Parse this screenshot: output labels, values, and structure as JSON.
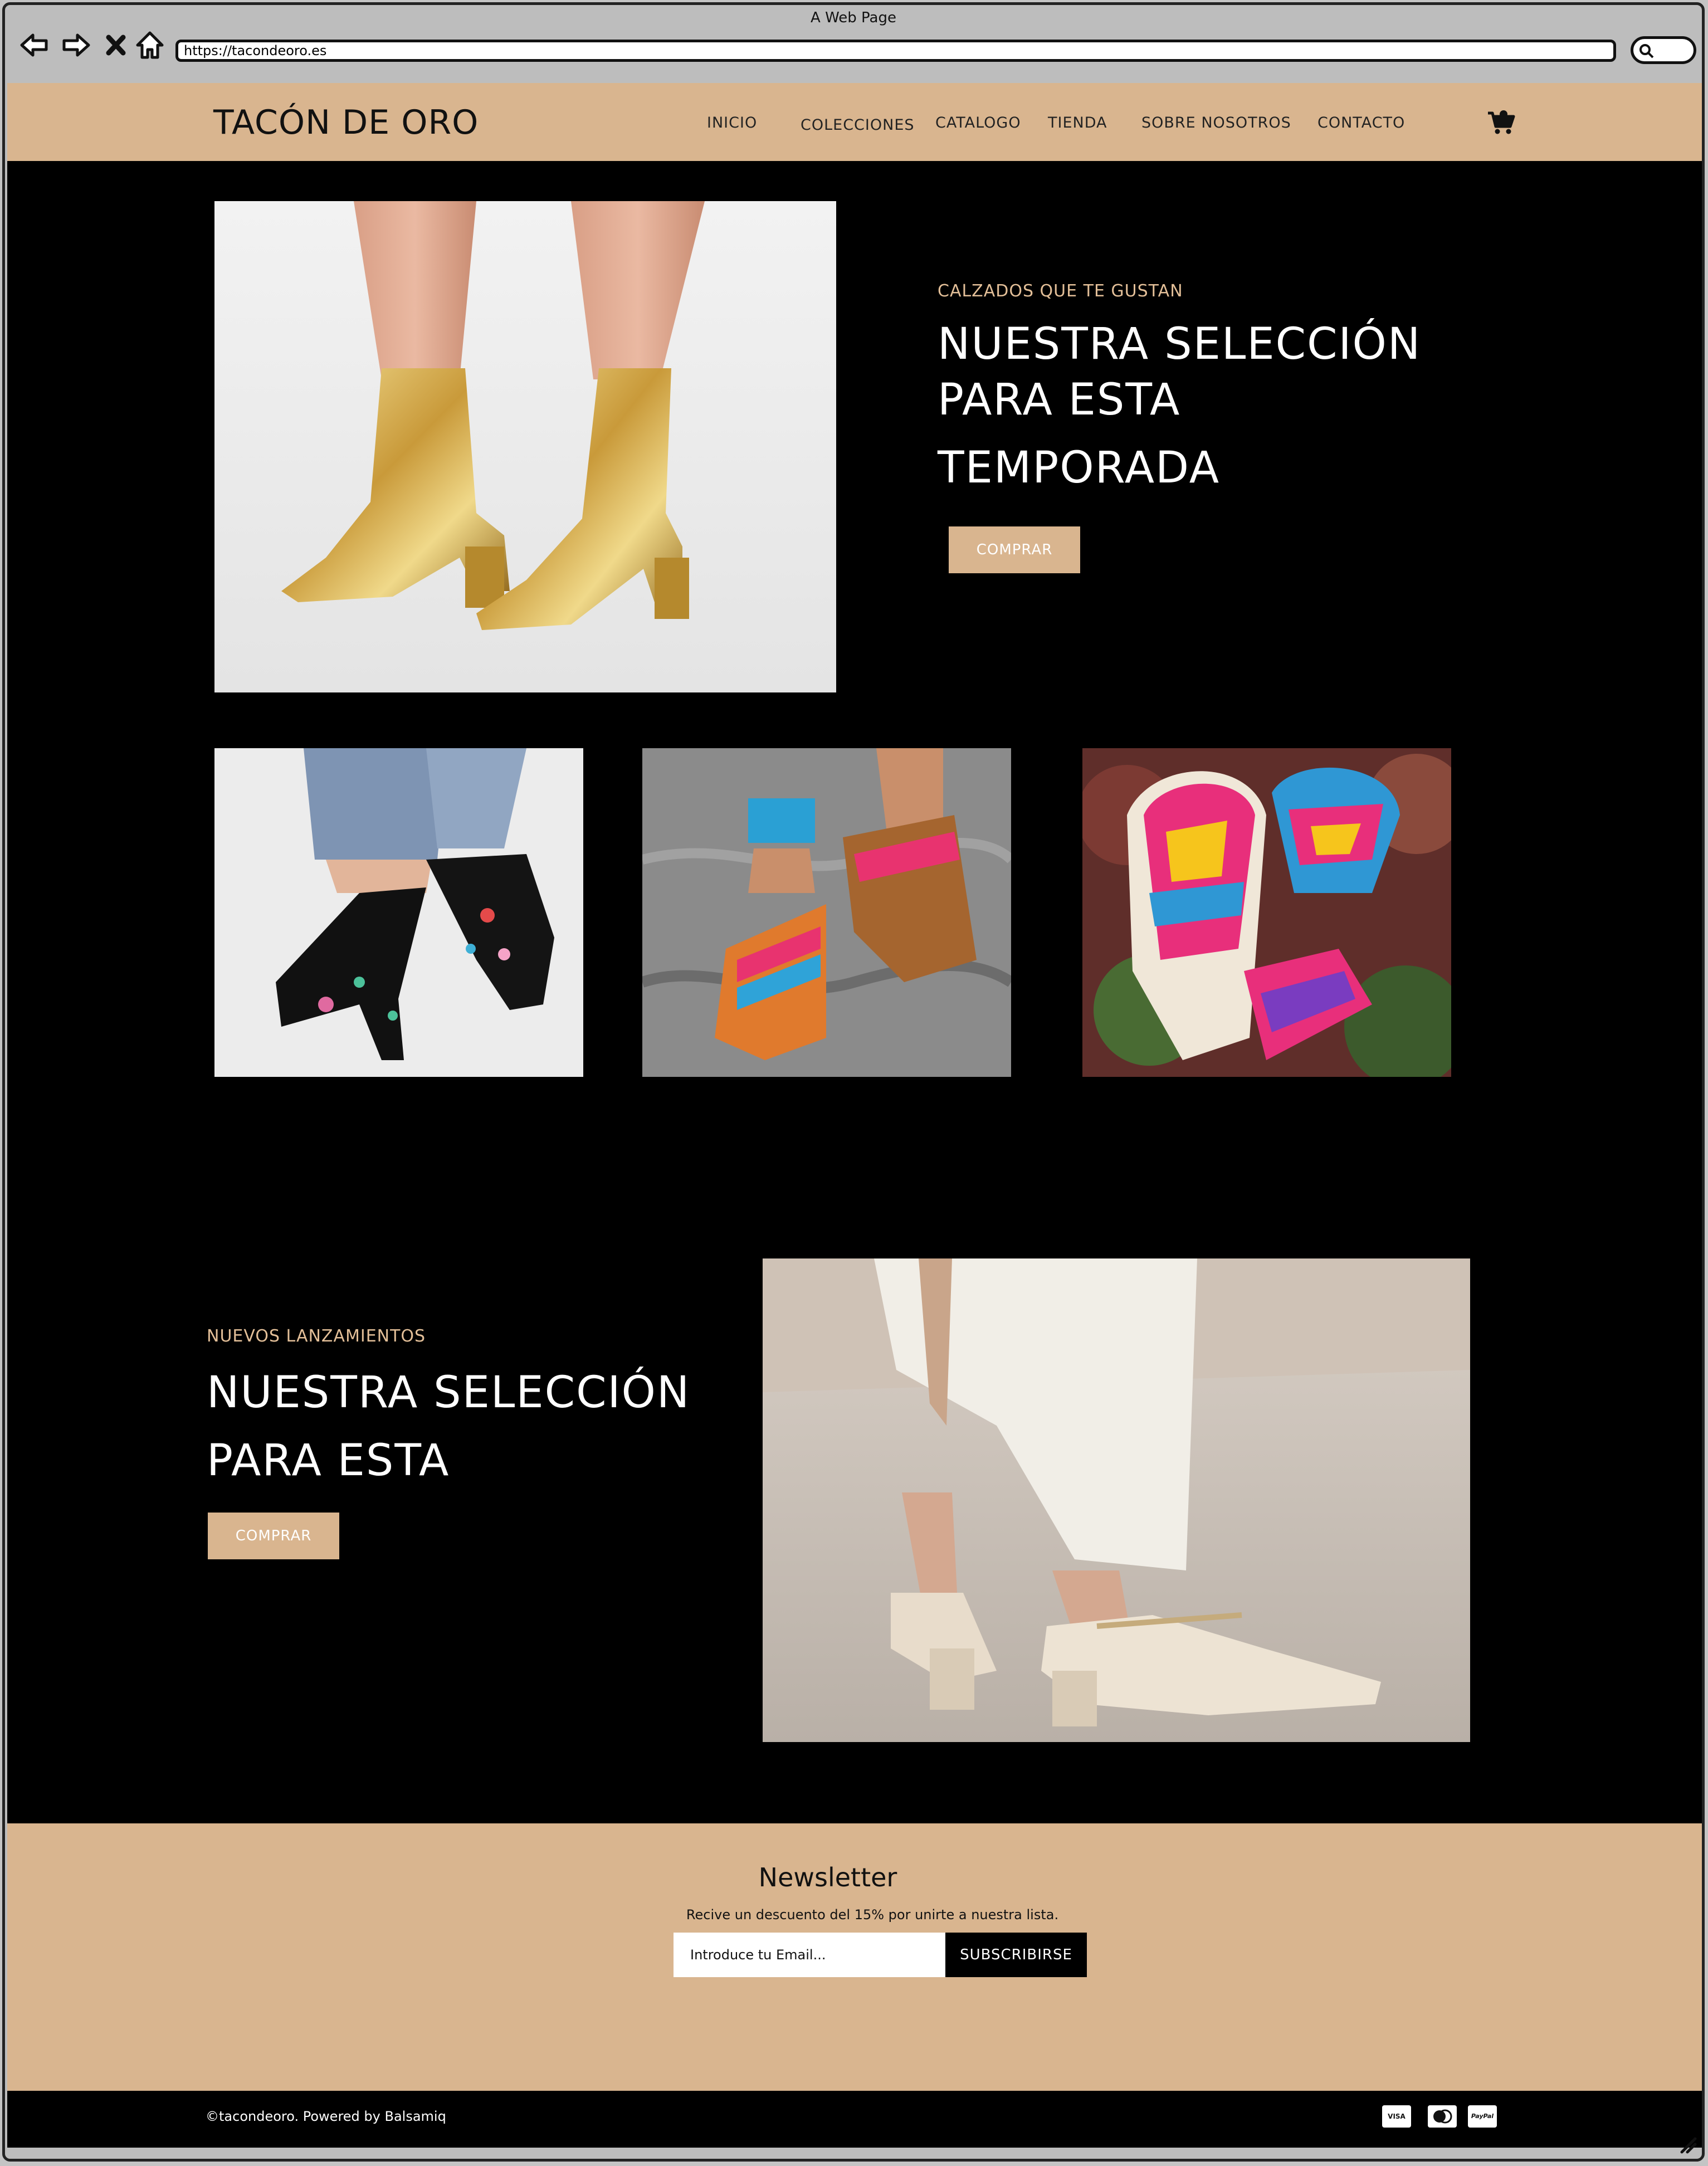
{
  "browser": {
    "window_title": "A Web Page",
    "url": "https://tacondeoro.es"
  },
  "header": {
    "brand": "TACÓN DE ORO",
    "menu": [
      {
        "label": "INICIO"
      },
      {
        "label": "COLECCIONES"
      },
      {
        "label": "CATALOGO"
      },
      {
        "label": "TIENDA"
      },
      {
        "label": "SOBRE NOSOTROS"
      },
      {
        "label": "CONTACTO"
      }
    ],
    "cart_icon": "shopping-cart-icon"
  },
  "hero": {
    "eyebrow": "CALZADOS QUE TE GUSTAN",
    "headline_lines": [
      "NUESTRA SELECCIÓN",
      "PARA ESTA",
      "TEMPORADA"
    ],
    "button": "COMPRAR"
  },
  "release": {
    "eyebrow": "NUEVOS LANZAMIENTOS",
    "headline_lines": [
      "NUESTRA SELECCIÓN",
      "PARA ESTA"
    ],
    "button": "COMPRAR"
  },
  "newsletter": {
    "title": "Newsletter",
    "subtitle": "Recive un descuento del 15% por unirte a nuestra lista.",
    "input_placeholder": "Introduce tu Email...",
    "button": "SUBSCRIBIRSE"
  },
  "footer": {
    "copyright": "©tacondeoro. Powered by Balsamiq",
    "payment_methods": [
      "VISA",
      "MC",
      "PayPal"
    ]
  },
  "colors": {
    "accent": "#d9b58f",
    "eyebrow": "#e3bf98",
    "background": "#000000"
  }
}
